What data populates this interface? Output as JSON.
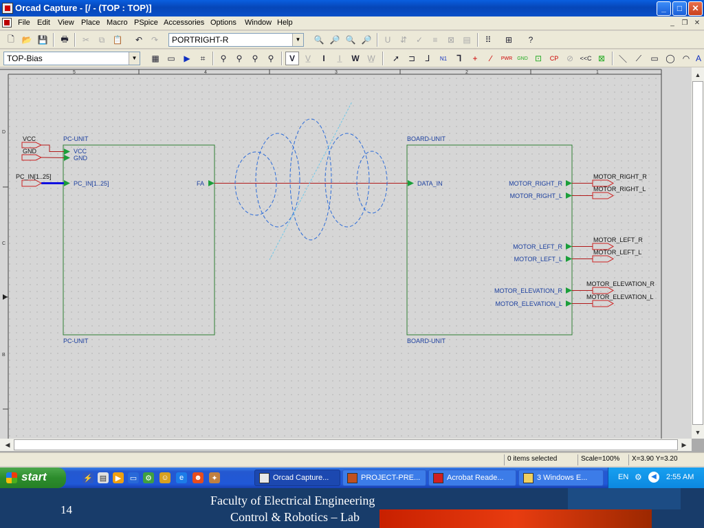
{
  "window": {
    "title": "Orcad Capture - [/ - (TOP : TOP)]"
  },
  "menu": [
    "File",
    "Edit",
    "View",
    "Place",
    "Macro",
    "PSpice",
    "Accessories",
    "Options",
    "Window",
    "Help"
  ],
  "toolbar1": {
    "part_combo": "PORTRIGHT-R"
  },
  "toolbar2": {
    "net_combo": "TOP-Bias",
    "tool_labels": {
      "v": "V",
      "i": "I",
      "w": "W",
      "n1": "N1",
      "pwr": "PWR",
      "gnd": "GND",
      "cp": "CP",
      "cc": "<<C"
    }
  },
  "schematic": {
    "border_zones_top": [
      "5",
      "4",
      "3",
      "2",
      "1"
    ],
    "border_zones_left": [
      "D",
      "C",
      "B"
    ],
    "pc_unit": {
      "title": "PC-UNIT",
      "footer": "PC-UNIT",
      "pins": [
        "VCC",
        "GND",
        "PC_IN[1..25]",
        "FA"
      ]
    },
    "board_unit": {
      "title": "BOARD-UNIT",
      "footer": "BOARD-UNIT",
      "pins": [
        "DATA_IN",
        "MOTOR_RIGHT_R",
        "MOTOR_RIGHT_L",
        "MOTOR_LEFT_R",
        "MOTOR_LEFT_L",
        "MOTOR_ELEVATION_R",
        "MOTOR_ELEVATION_L"
      ]
    },
    "left_ports": [
      "VCC",
      "GND",
      "PC_IN[1..25]"
    ],
    "right_ports": [
      "MOTOR_RIGHT_R",
      "MOTOR_RIGHT_L",
      "MOTOR_LEFT_R",
      "MOTOR_LEFT_L",
      "MOTOR_ELEVATION_R",
      "MOTOR_ELEVATION_L"
    ]
  },
  "status": {
    "selection": "0 items selected",
    "scale": "Scale=100%",
    "coords": "X=3.90  Y=3.20"
  },
  "taskbar": {
    "start": "start",
    "tasks": [
      "Orcad Capture...",
      "PROJECT-PRE...",
      "Acrobat Reade...",
      "3 Windows E..."
    ],
    "lang": "EN",
    "clock": "2:55 AM"
  },
  "slide": {
    "number": "14",
    "line1": "Faculty of Electrical Engineering",
    "line2": "Control & Robotics – Lab"
  },
  "colors": {
    "part_green": "#2e7d32",
    "pin_green": "#1b9e3a",
    "text_blue": "#1a3e9e",
    "wire_red": "#b01818",
    "port_red": "#cc2020",
    "bus_blue": "#1010e0",
    "titlebar": "#0a50c8",
    "slide_bg": "#183c6a"
  }
}
